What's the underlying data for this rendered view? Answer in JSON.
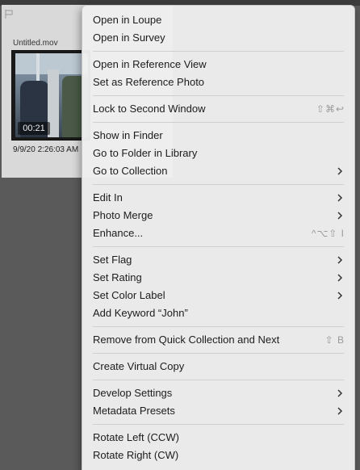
{
  "grid": {
    "filename": "Untitled.mov",
    "duration": "00:21",
    "capture_date": "9/9/20 2:26:03 AM"
  },
  "menu": {
    "groups": [
      [
        {
          "label": "Open in Loupe"
        },
        {
          "label": "Open in Survey"
        }
      ],
      [
        {
          "label": "Open in Reference View"
        },
        {
          "label": "Set as Reference Photo"
        }
      ],
      [
        {
          "label": "Lock to Second Window",
          "shortcut": "⇧⌘↩"
        }
      ],
      [
        {
          "label": "Show in Finder"
        },
        {
          "label": "Go to Folder in Library"
        },
        {
          "label": "Go to Collection",
          "submenu": true
        }
      ],
      [
        {
          "label": "Edit In",
          "submenu": true
        },
        {
          "label": "Photo Merge",
          "submenu": true
        },
        {
          "label": "Enhance...",
          "shortcut": "^⌥⇧ I"
        }
      ],
      [
        {
          "label": "Set Flag",
          "submenu": true
        },
        {
          "label": "Set Rating",
          "submenu": true
        },
        {
          "label": "Set Color Label",
          "submenu": true
        },
        {
          "label": "Add Keyword “John”"
        }
      ],
      [
        {
          "label": "Remove from Quick Collection and Next",
          "shortcut": "⇧ B"
        }
      ],
      [
        {
          "label": "Create Virtual Copy"
        }
      ],
      [
        {
          "label": "Develop Settings",
          "submenu": true
        },
        {
          "label": "Metadata Presets",
          "submenu": true
        }
      ],
      [
        {
          "label": "Rotate Left (CCW)"
        },
        {
          "label": "Rotate Right (CW)"
        }
      ]
    ]
  }
}
